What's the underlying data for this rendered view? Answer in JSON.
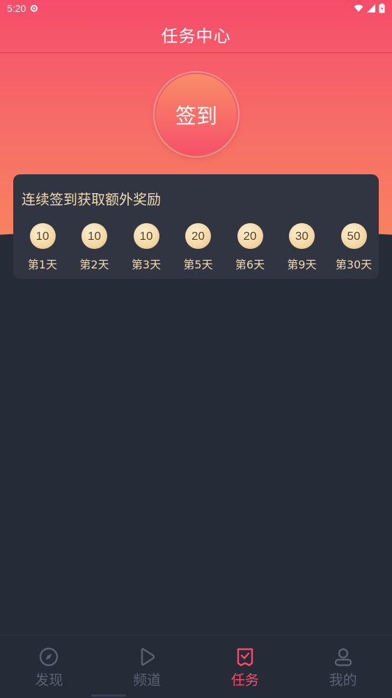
{
  "status_bar": {
    "time": "5:20"
  },
  "header": {
    "title": "任务中心"
  },
  "signin": {
    "label": "签到"
  },
  "reward_card": {
    "title": "连续签到获取额外奖励",
    "items": [
      {
        "points": "10",
        "day": "第1天"
      },
      {
        "points": "10",
        "day": "第2天"
      },
      {
        "points": "10",
        "day": "第3天"
      },
      {
        "points": "20",
        "day": "第5天"
      },
      {
        "points": "20",
        "day": "第6天"
      },
      {
        "points": "30",
        "day": "第9天"
      },
      {
        "points": "50",
        "day": "第30天"
      }
    ]
  },
  "bottom_nav": {
    "items": [
      {
        "label": "发现",
        "icon": "compass-icon",
        "active": false
      },
      {
        "label": "频道",
        "icon": "play-icon",
        "active": false
      },
      {
        "label": "任务",
        "icon": "task-check-icon",
        "active": true
      },
      {
        "label": "我的",
        "icon": "user-icon",
        "active": false
      }
    ]
  },
  "colors": {
    "accent": "#f64c6a",
    "background": "#262b38",
    "card": "#313542",
    "gold_text": "#f2dbb0",
    "nav_inactive": "#5b6272"
  }
}
